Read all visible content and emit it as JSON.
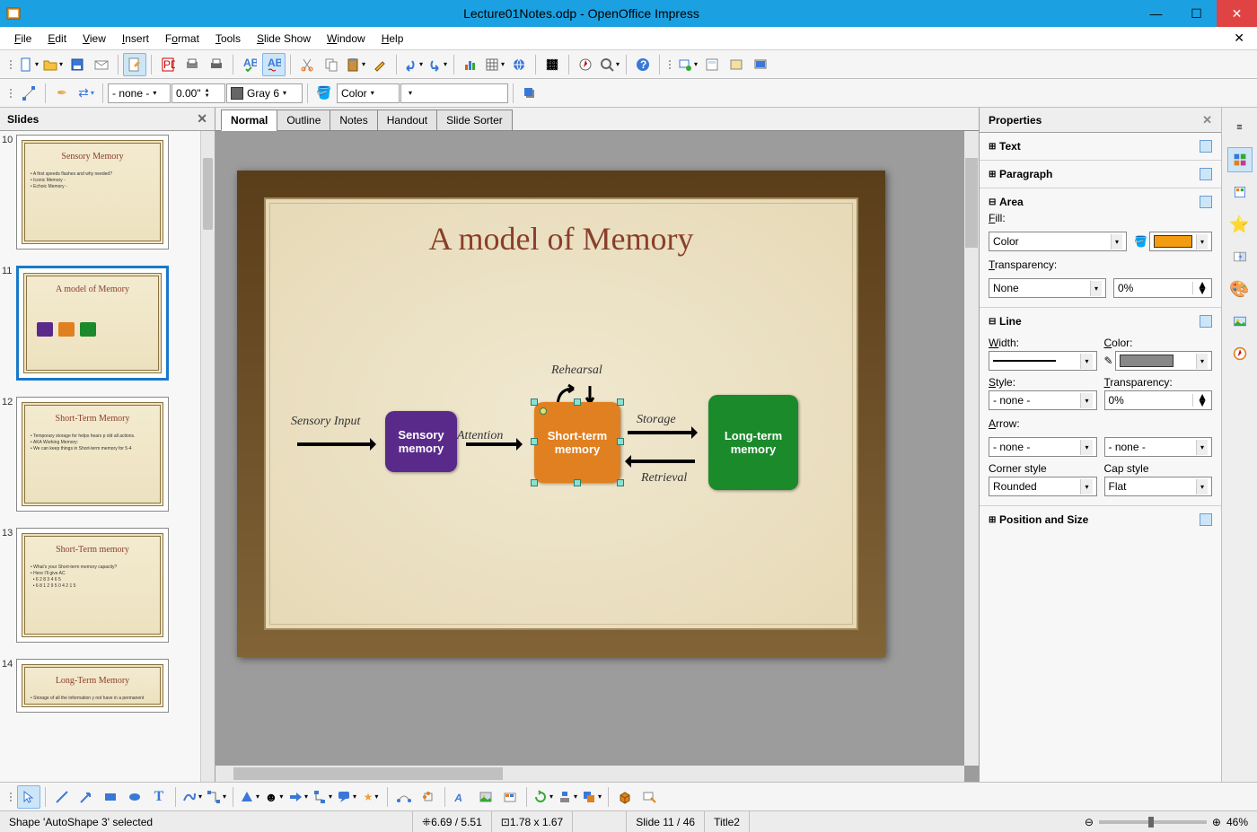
{
  "window": {
    "title": "Lecture01Notes.odp - OpenOffice Impress"
  },
  "menu": {
    "items": [
      "File",
      "Edit",
      "View",
      "Insert",
      "Format",
      "Tools",
      "Slide Show",
      "Window",
      "Help"
    ]
  },
  "toolbar2": {
    "style": "- none -",
    "width": "0.00\"",
    "linecolor": "Gray 6",
    "filltype": "Color",
    "fillcolor": ""
  },
  "slidespanel": {
    "title": "Slides",
    "thumbs": [
      {
        "num": "10",
        "title": "Sensory Memory"
      },
      {
        "num": "11",
        "title": "A model of Memory",
        "selected": true,
        "diagram": true
      },
      {
        "num": "12",
        "title": "Short-Term Memory"
      },
      {
        "num": "13",
        "title": "Short-Term memory"
      },
      {
        "num": "14",
        "title": "Long-Term Memory"
      }
    ]
  },
  "viewtabs": {
    "tabs": [
      "Normal",
      "Outline",
      "Notes",
      "Handout",
      "Slide Sorter"
    ],
    "active": "Normal"
  },
  "slide": {
    "title": "A model of Memory",
    "boxes": {
      "sensory": "Sensory memory",
      "short": "Short-term memory",
      "long": "Long-term memory"
    },
    "labels": {
      "sensory_input": "Sensory Input",
      "attention": "Attention",
      "rehearsal": "Rehearsal",
      "storage": "Storage",
      "retrieval": "Retrieval"
    }
  },
  "properties": {
    "title": "Properties",
    "sections": {
      "text": "Text",
      "paragraph": "Paragraph",
      "area": "Area",
      "line": "Line",
      "position": "Position and Size"
    },
    "area": {
      "fill_label": "Fill:",
      "fill_type": "Color",
      "fill_color": "#f39c12",
      "transparency_label": "Transparency:",
      "transparency_type": "None",
      "transparency_value": "0%"
    },
    "line": {
      "width_label": "Width:",
      "color_label": "Color:",
      "line_color": "#888888",
      "style_label": "Style:",
      "style": "- none -",
      "transparency_label": "Transparency:",
      "transparency": "0%",
      "arrow_label": "Arrow:",
      "arrow_start": "- none -",
      "arrow_end": "- none -",
      "corner_label": "Corner style",
      "corner": "Rounded",
      "cap_label": "Cap style",
      "cap": "Flat"
    }
  },
  "status": {
    "selection": "Shape 'AutoShape 3' selected",
    "pos": "6.69 / 5.51",
    "size": "1.78 x 1.67",
    "slide": "Slide 11 / 46",
    "layout": "Title2",
    "zoom": "46%"
  }
}
